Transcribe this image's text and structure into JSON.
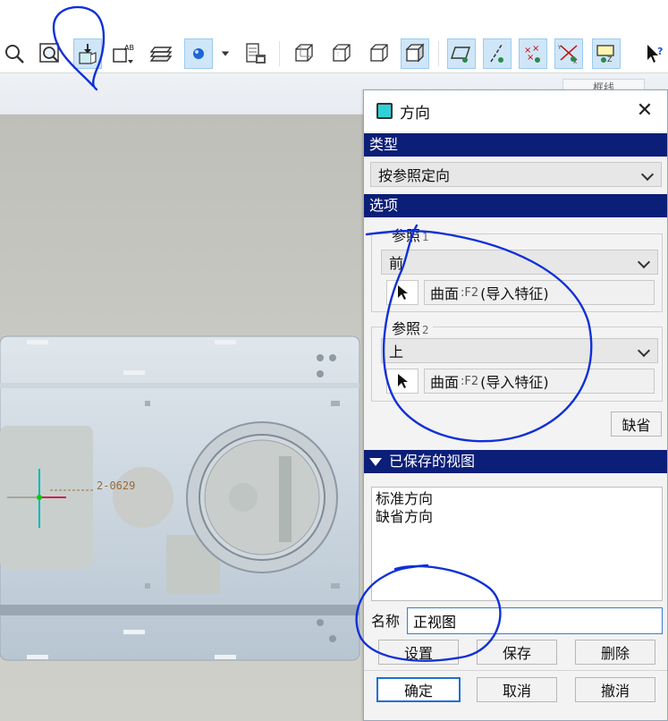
{
  "toolbar": {
    "icons": [
      "zoom-out-icon",
      "zoom-window-icon",
      "refit-icon",
      "annotation-display-icon",
      "layer-icon",
      "datum-point-icon",
      "dropdown-arrow-icon",
      "saved-views-icon",
      "view-wireframe-icon",
      "view-hidden-line-icon",
      "view-no-hidden-icon",
      "view-shading-icon",
      "plane-display-icon",
      "axis-display-icon",
      "point-display-icon",
      "csys-display-icon",
      "annotation-visibility-icon",
      "select-cursor-icon"
    ],
    "selected_color": "#cfe6f8"
  },
  "viewport_header": {
    "note": "框线"
  },
  "model": {
    "dimension_text": "2-0629"
  },
  "dialog": {
    "title": "方向",
    "close_symbol": "✕",
    "type_section": "类型",
    "type_value": "按参照定向",
    "options_section": "选项",
    "ref1_label": "参照",
    "ref1_index": "1",
    "ref1_value": "前",
    "ref1_field_prefix": "曲面",
    "ref1_field_code": ":F2",
    "ref1_field_suffix": "(导入特征)",
    "ref2_label": "参照",
    "ref2_index": "2",
    "ref2_value": "上",
    "ref2_field_prefix": "曲面",
    "ref2_field_code": ":F2",
    "ref2_field_suffix": "(导入特征)",
    "default_button": "缺省",
    "saved_views_section": "已保存的视图",
    "saved_views": [
      "标准方向",
      "缺省方向"
    ],
    "name_label": "名称",
    "name_value": "正视图",
    "set_button": "设置",
    "save_button": "保存",
    "delete_button": "删除",
    "ok_button": "确定",
    "cancel_button": "取消",
    "undo_button": "撤消"
  },
  "colors": {
    "section_header": "#0b1e78",
    "annotation_ink": "#1030d8",
    "title_icon_fill": "#2fd1d6",
    "primary_border": "#1f6fd1"
  }
}
